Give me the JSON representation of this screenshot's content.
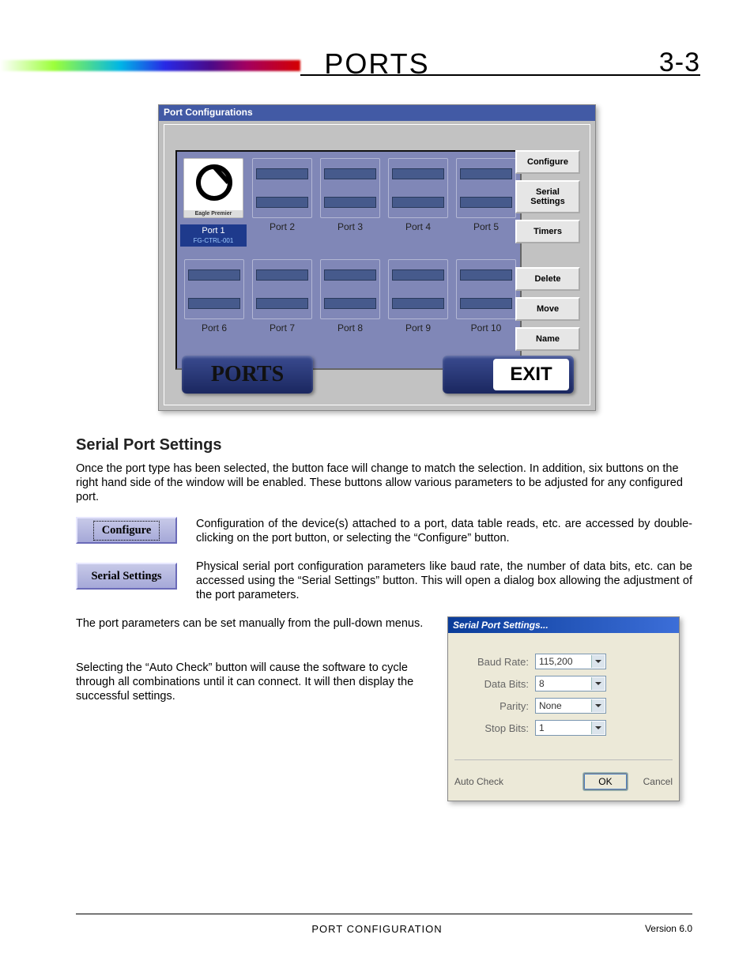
{
  "header": {
    "title": "PORTS",
    "page": "3-3"
  },
  "shot1": {
    "window_title": "Port Configurations",
    "eagle_label": "Eagle Premier",
    "selected_port": {
      "label": "Port 1",
      "sub": "FG-CTRL-001"
    },
    "ports_row1": [
      "Port 2",
      "Port 3",
      "Port 4",
      "Port 5"
    ],
    "ports_row2": [
      "Port 6",
      "Port 7",
      "Port 8",
      "Port 9",
      "Port 10"
    ],
    "side_buttons": [
      "Configure",
      "Serial Settings",
      "Timers",
      "Delete",
      "Move",
      "Name"
    ],
    "bottom_label": "PORTS",
    "exit_label": "EXIT"
  },
  "section_heading": "Serial Port Settings",
  "para1": "Once the port type has been selected, the button face will change to match the selection.  In addition, six buttons on the right hand side of the window will be enabled.  These buttons allow various parameters to be adjusted for any configured port.",
  "para2": "Configuration of the device(s) attached to a port, data table reads, etc. are accessed by double-clicking on the port button, or selecting the “Configure” button.",
  "para3": "Physical serial port configuration parameters like baud rate, the number of data bits, etc. can be accessed using the “Serial Settings” button.  This will open a dialog box allowing the adjustment of the port parameters.",
  "para4": "The port parameters can be set manually from the pull-down menus.",
  "para5": "Selecting the “Auto Check” button will cause the software to cycle through all combinations until it can connect.  It will then display the successful settings.",
  "inline_buttons": {
    "configure": "Configure",
    "serial": "Serial Settings"
  },
  "dialog": {
    "title": "Serial Port Settings...",
    "fields": {
      "baud": {
        "label": "Baud Rate:",
        "value": "115,200"
      },
      "data": {
        "label": "Data Bits:",
        "value": "8"
      },
      "parity": {
        "label": "Parity:",
        "value": "None"
      },
      "stop": {
        "label": "Stop Bits:",
        "value": "1"
      }
    },
    "auto_check": "Auto Check",
    "ok": "OK",
    "cancel": "Cancel"
  },
  "footer": {
    "center": "PORT CONFIGURATION",
    "right": "Version 6.0"
  }
}
